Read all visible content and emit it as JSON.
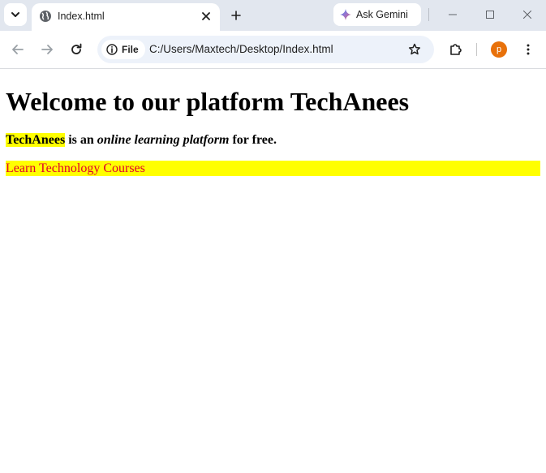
{
  "tabstrip": {
    "tab": {
      "title": "Index.html"
    },
    "gemini": {
      "label": "Ask Gemini"
    }
  },
  "toolbar": {
    "file_chip": "File",
    "url": "C:/Users/Maxtech/Desktop/Index.html",
    "avatar_initial": "p"
  },
  "page": {
    "heading": "Welcome to our platform TechAnees",
    "lead": {
      "brand": "TechAnees",
      "part1": " is an ",
      "emphasis": "online learning platform",
      "part2": " for free."
    },
    "courses_text": "Learn Technology Courses"
  },
  "colors": {
    "highlight": "#ffff00",
    "courses_text": "#e0002a",
    "avatar": "#e8710a",
    "tabstrip_bg": "#e2e7ef",
    "omnibox_bg": "#edf2fa"
  }
}
